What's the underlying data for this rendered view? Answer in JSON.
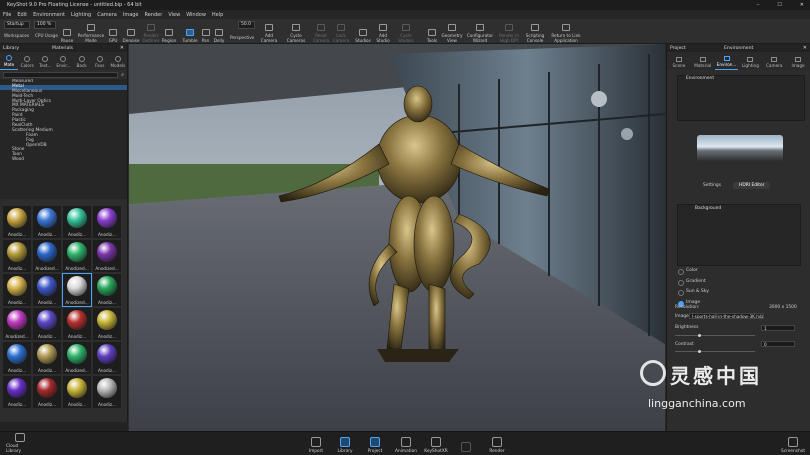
{
  "window": {
    "title": "KeyShot 9.0 Pro Floating License - untitled.bip - 64 bit",
    "controls": [
      "–",
      "☐",
      "✕"
    ]
  },
  "menu": [
    "File",
    "Edit",
    "Environment",
    "Lighting",
    "Camera",
    "Image",
    "Render",
    "View",
    "Window",
    "Help"
  ],
  "toolbar": {
    "startup_value": "Startup",
    "cpu_value": "100 %",
    "workspaces_label": "Workspaces",
    "cpu_usage_label": "CPU Usage",
    "fov_value": "50.0",
    "buttons": [
      "Pause",
      "Performance Mode",
      "GPU",
      "Denoise",
      "Render Outlines",
      "Region",
      "Tumble",
      "Pan",
      "Dolly",
      "Perspective",
      "Add Camera",
      "Cycle Cameras",
      "Reset Camera",
      "Lock Camera",
      "Studios",
      "Add Studio",
      "Cycle Studios",
      "Tools",
      "Geometry View",
      "Configurator Wizard",
      "Render in High DPI",
      "Scripting Console",
      "Return to Link Application"
    ]
  },
  "left_panel": {
    "tabs": [
      "Library",
      "Materials"
    ],
    "categories": [
      {
        "label": "Mate",
        "icon": "material-icon"
      },
      {
        "label": "Colors",
        "icon": "colors-icon"
      },
      {
        "label": "Text...",
        "icon": "texture-icon"
      },
      {
        "label": "Envir...",
        "icon": "environment-icon"
      },
      {
        "label": "Back",
        "icon": "backplate-icon"
      },
      {
        "label": "Favs",
        "icon": "favorites-icon"
      },
      {
        "label": "Models",
        "icon": "models-icon"
      }
    ],
    "tree": [
      {
        "label": "Measured",
        "level": 0
      },
      {
        "label": "Metal",
        "level": 0,
        "selected": true
      },
      {
        "label": "Miscellaneous",
        "level": 0
      },
      {
        "label": "Mold-Tech",
        "level": 0
      },
      {
        "label": "Multi-Layer Optics",
        "level": 0
      },
      {
        "label": "MX MATERIALS",
        "level": 0
      },
      {
        "label": "Packaging",
        "level": 0
      },
      {
        "label": "Paint",
        "level": 0
      },
      {
        "label": "Plastic",
        "level": 0
      },
      {
        "label": "RealCloth",
        "level": 0
      },
      {
        "label": "Scattering Medium",
        "level": 0
      },
      {
        "label": "Foam",
        "level": 1
      },
      {
        "label": "Fog",
        "level": 1
      },
      {
        "label": "OpenVDB",
        "level": 1
      },
      {
        "label": "Stone",
        "level": 0
      },
      {
        "label": "Toon",
        "level": 0
      },
      {
        "label": "Wood",
        "level": 0
      }
    ],
    "thumbnails": [
      {
        "label": "Anodiz...",
        "color": "#c9a640"
      },
      {
        "label": "Anodiz...",
        "color": "#3d76d6"
      },
      {
        "label": "Anodiz...",
        "color": "#34c39a"
      },
      {
        "label": "Anodiz...",
        "color": "#8a3fd0"
      },
      {
        "label": "Anodiz...",
        "color": "#b39a3a"
      },
      {
        "label": "Anodized...",
        "color": "#2a66c8"
      },
      {
        "label": "Anodized...",
        "color": "#2fb36b"
      },
      {
        "label": "Anodized...",
        "color": "#7a35a8"
      },
      {
        "label": "Anodiz...",
        "color": "#d3b14a"
      },
      {
        "label": "Anodiz...",
        "color": "#3f57c8"
      },
      {
        "label": "Anodized...",
        "color": "#d8d8d8",
        "selected": true
      },
      {
        "label": "Anodiz...",
        "color": "#2aa55a"
      },
      {
        "label": "Anodized...",
        "color": "#c03ac0"
      },
      {
        "label": "Anodiz...",
        "color": "#5a4ac8"
      },
      {
        "label": "Anodiz...",
        "color": "#b83030"
      },
      {
        "label": "Anodiz...",
        "color": "#c9b53a"
      },
      {
        "label": "Anodiz...",
        "color": "#2d6fd0"
      },
      {
        "label": "Anodiz...",
        "color": "#b09a55"
      },
      {
        "label": "Anodized...",
        "color": "#2fb36b"
      },
      {
        "label": "Anodiz...",
        "color": "#5f3fbf"
      },
      {
        "label": "Anodiz...",
        "color": "#6a2fc8"
      },
      {
        "label": "Anodiz...",
        "color": "#a52a2a"
      },
      {
        "label": "Anodiz...",
        "color": "#c9b53a"
      },
      {
        "label": "Anodiz...",
        "color": "#b9b9b9"
      }
    ]
  },
  "right_panel": {
    "tabs": [
      "Project",
      "Environment"
    ],
    "subtabs": [
      {
        "label": "Scene",
        "icon": "scene-icon"
      },
      {
        "label": "Material",
        "icon": "material-icon"
      },
      {
        "label": "Environ...",
        "icon": "environment-icon"
      },
      {
        "label": "Lighting",
        "icon": "lighting-icon"
      },
      {
        "label": "Camera",
        "icon": "camera-icon"
      },
      {
        "label": "Image",
        "icon": "image-icon"
      }
    ],
    "environment_item": "Environment",
    "env_view_tabs": [
      "Settings",
      "HDRI Editor"
    ],
    "background_item": "Background",
    "background_options": [
      "Color",
      "Gradient",
      "Sun & Sky",
      "Image"
    ],
    "selected_option": "Image",
    "resolution_label": "Resolution:",
    "resolution_value": "3000 x 1500",
    "image_label": "Image",
    "image_value": "l-sports-hall-in-the-shadow-3K.hdz",
    "brightness_label": "Brightness",
    "brightness_value": "1",
    "contrast_label": "Contrast",
    "contrast_value": "0",
    "brightness_level": 0.3,
    "contrast_level": 0.3
  },
  "bottom_bar": {
    "cloud_library": "Cloud Library",
    "buttons": [
      {
        "label": "Import",
        "state": "normal"
      },
      {
        "label": "Library",
        "state": "active"
      },
      {
        "label": "Project",
        "state": "active"
      },
      {
        "label": "Animation",
        "state": "normal"
      },
      {
        "label": "KeyShotXR",
        "state": "normal"
      },
      {
        "label": "",
        "state": "dim"
      },
      {
        "label": "Render",
        "state": "normal"
      }
    ],
    "screenshot_label": "Screenshot"
  },
  "watermark": {
    "brand": "灵感中国",
    "url": "lingganchina.com"
  }
}
